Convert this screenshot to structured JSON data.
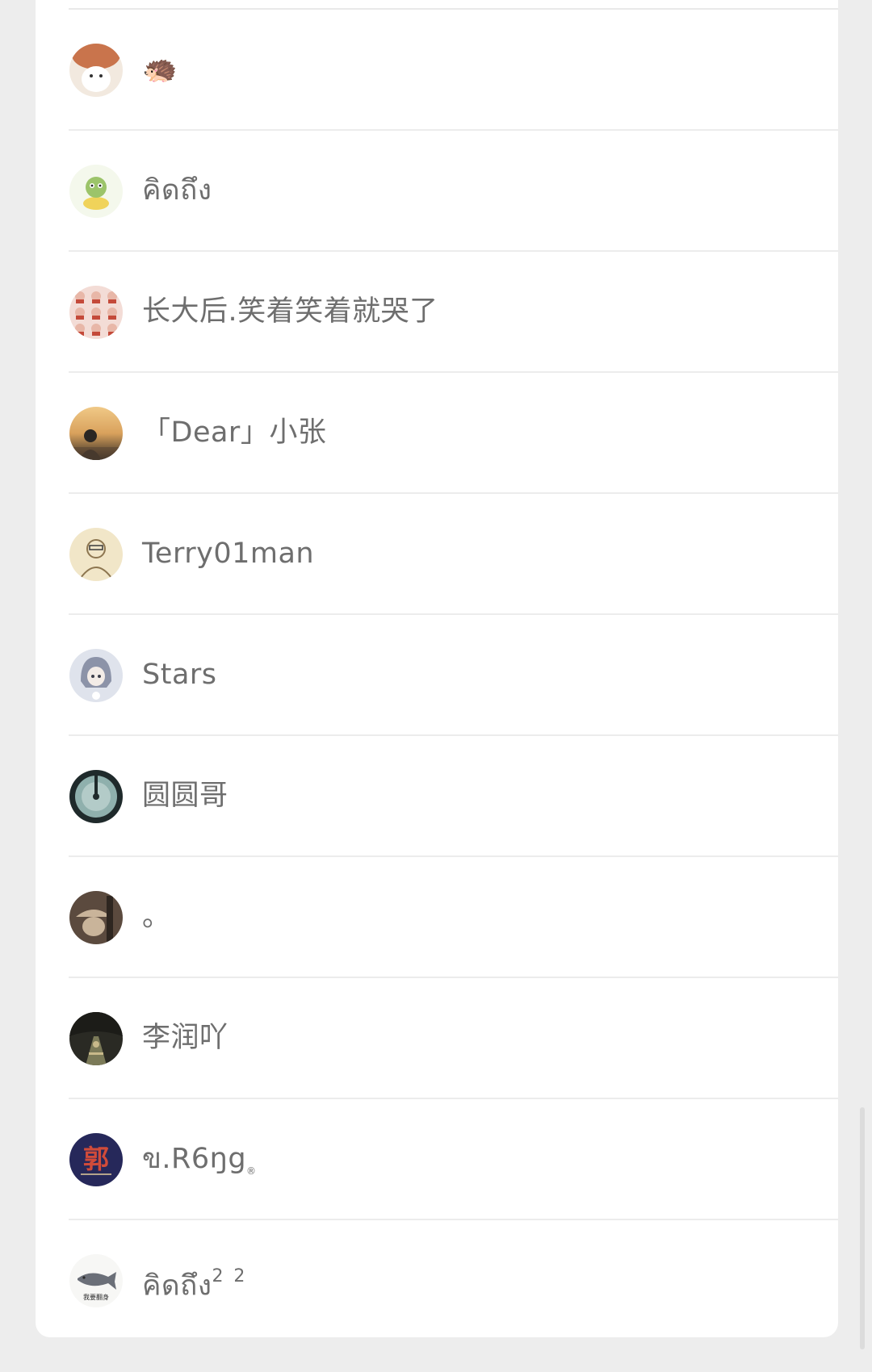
{
  "contacts": [
    {
      "name": "",
      "emoji": "🦔",
      "avatar_icon": "hedgehog-avatar-icon",
      "avatar_colors": [
        "#c9744c",
        "#f2e9df"
      ]
    },
    {
      "name": "คิดถึง",
      "avatar_icon": "cartoon-character-avatar-icon",
      "avatar_colors": [
        "#f4f8ec",
        "#9cc46a",
        "#f0d35a"
      ]
    },
    {
      "name": "长大后.笑着笑着就哭了",
      "avatar_icon": "photo-grid-avatar-icon",
      "avatar_colors": [
        "#f3dcd6",
        "#c44a3a",
        "#e8b7a8"
      ]
    },
    {
      "name": "「Dear」小张",
      "avatar_icon": "sunset-person-avatar-icon",
      "avatar_colors": [
        "#d9a15c",
        "#5b4634",
        "#2a2623"
      ]
    },
    {
      "name": "Terry01man",
      "avatar_icon": "sketch-portrait-avatar-icon",
      "avatar_colors": [
        "#f1e6c8",
        "#8d7650",
        "#3a3a3a"
      ]
    },
    {
      "name": "Stars",
      "avatar_icon": "anime-girl-avatar-icon",
      "avatar_colors": [
        "#dfe3ec",
        "#8c93a8",
        "#3c3f4a"
      ]
    },
    {
      "name": "圆圆哥",
      "avatar_icon": "jade-disc-avatar-icon",
      "avatar_colors": [
        "#1f2a2b",
        "#8fb0ad",
        "#d8e6e3"
      ]
    },
    {
      "name": "。",
      "avatar_icon": "dog-hat-avatar-icon",
      "avatar_colors": [
        "#5b4a3e",
        "#c9b49a",
        "#2e2620"
      ]
    },
    {
      "name": "李润吖",
      "avatar_icon": "night-street-avatar-icon",
      "avatar_colors": [
        "#2a2a24",
        "#7b7a58",
        "#c8b98a"
      ]
    },
    {
      "name": "ข.R6ŋg",
      "name_suffix": "®",
      "avatar_icon": "calligraphy-guo-avatar-icon",
      "avatar_glyph": "郭",
      "avatar_colors": [
        "#26285a",
        "#d14b3a",
        "#f1d7a0"
      ]
    },
    {
      "name": "คิดถึง",
      "superscript": "2 2",
      "avatar_icon": "fish-painting-avatar-icon",
      "avatar_caption": "我要翻身",
      "avatar_colors": [
        "#f7f7f5",
        "#6b6f78",
        "#2a2a2a"
      ]
    }
  ],
  "colors": {
    "page_background": "#ededed",
    "card_background": "#ffffff",
    "divider": "#ececec",
    "name_text": "#6e6e6e"
  }
}
